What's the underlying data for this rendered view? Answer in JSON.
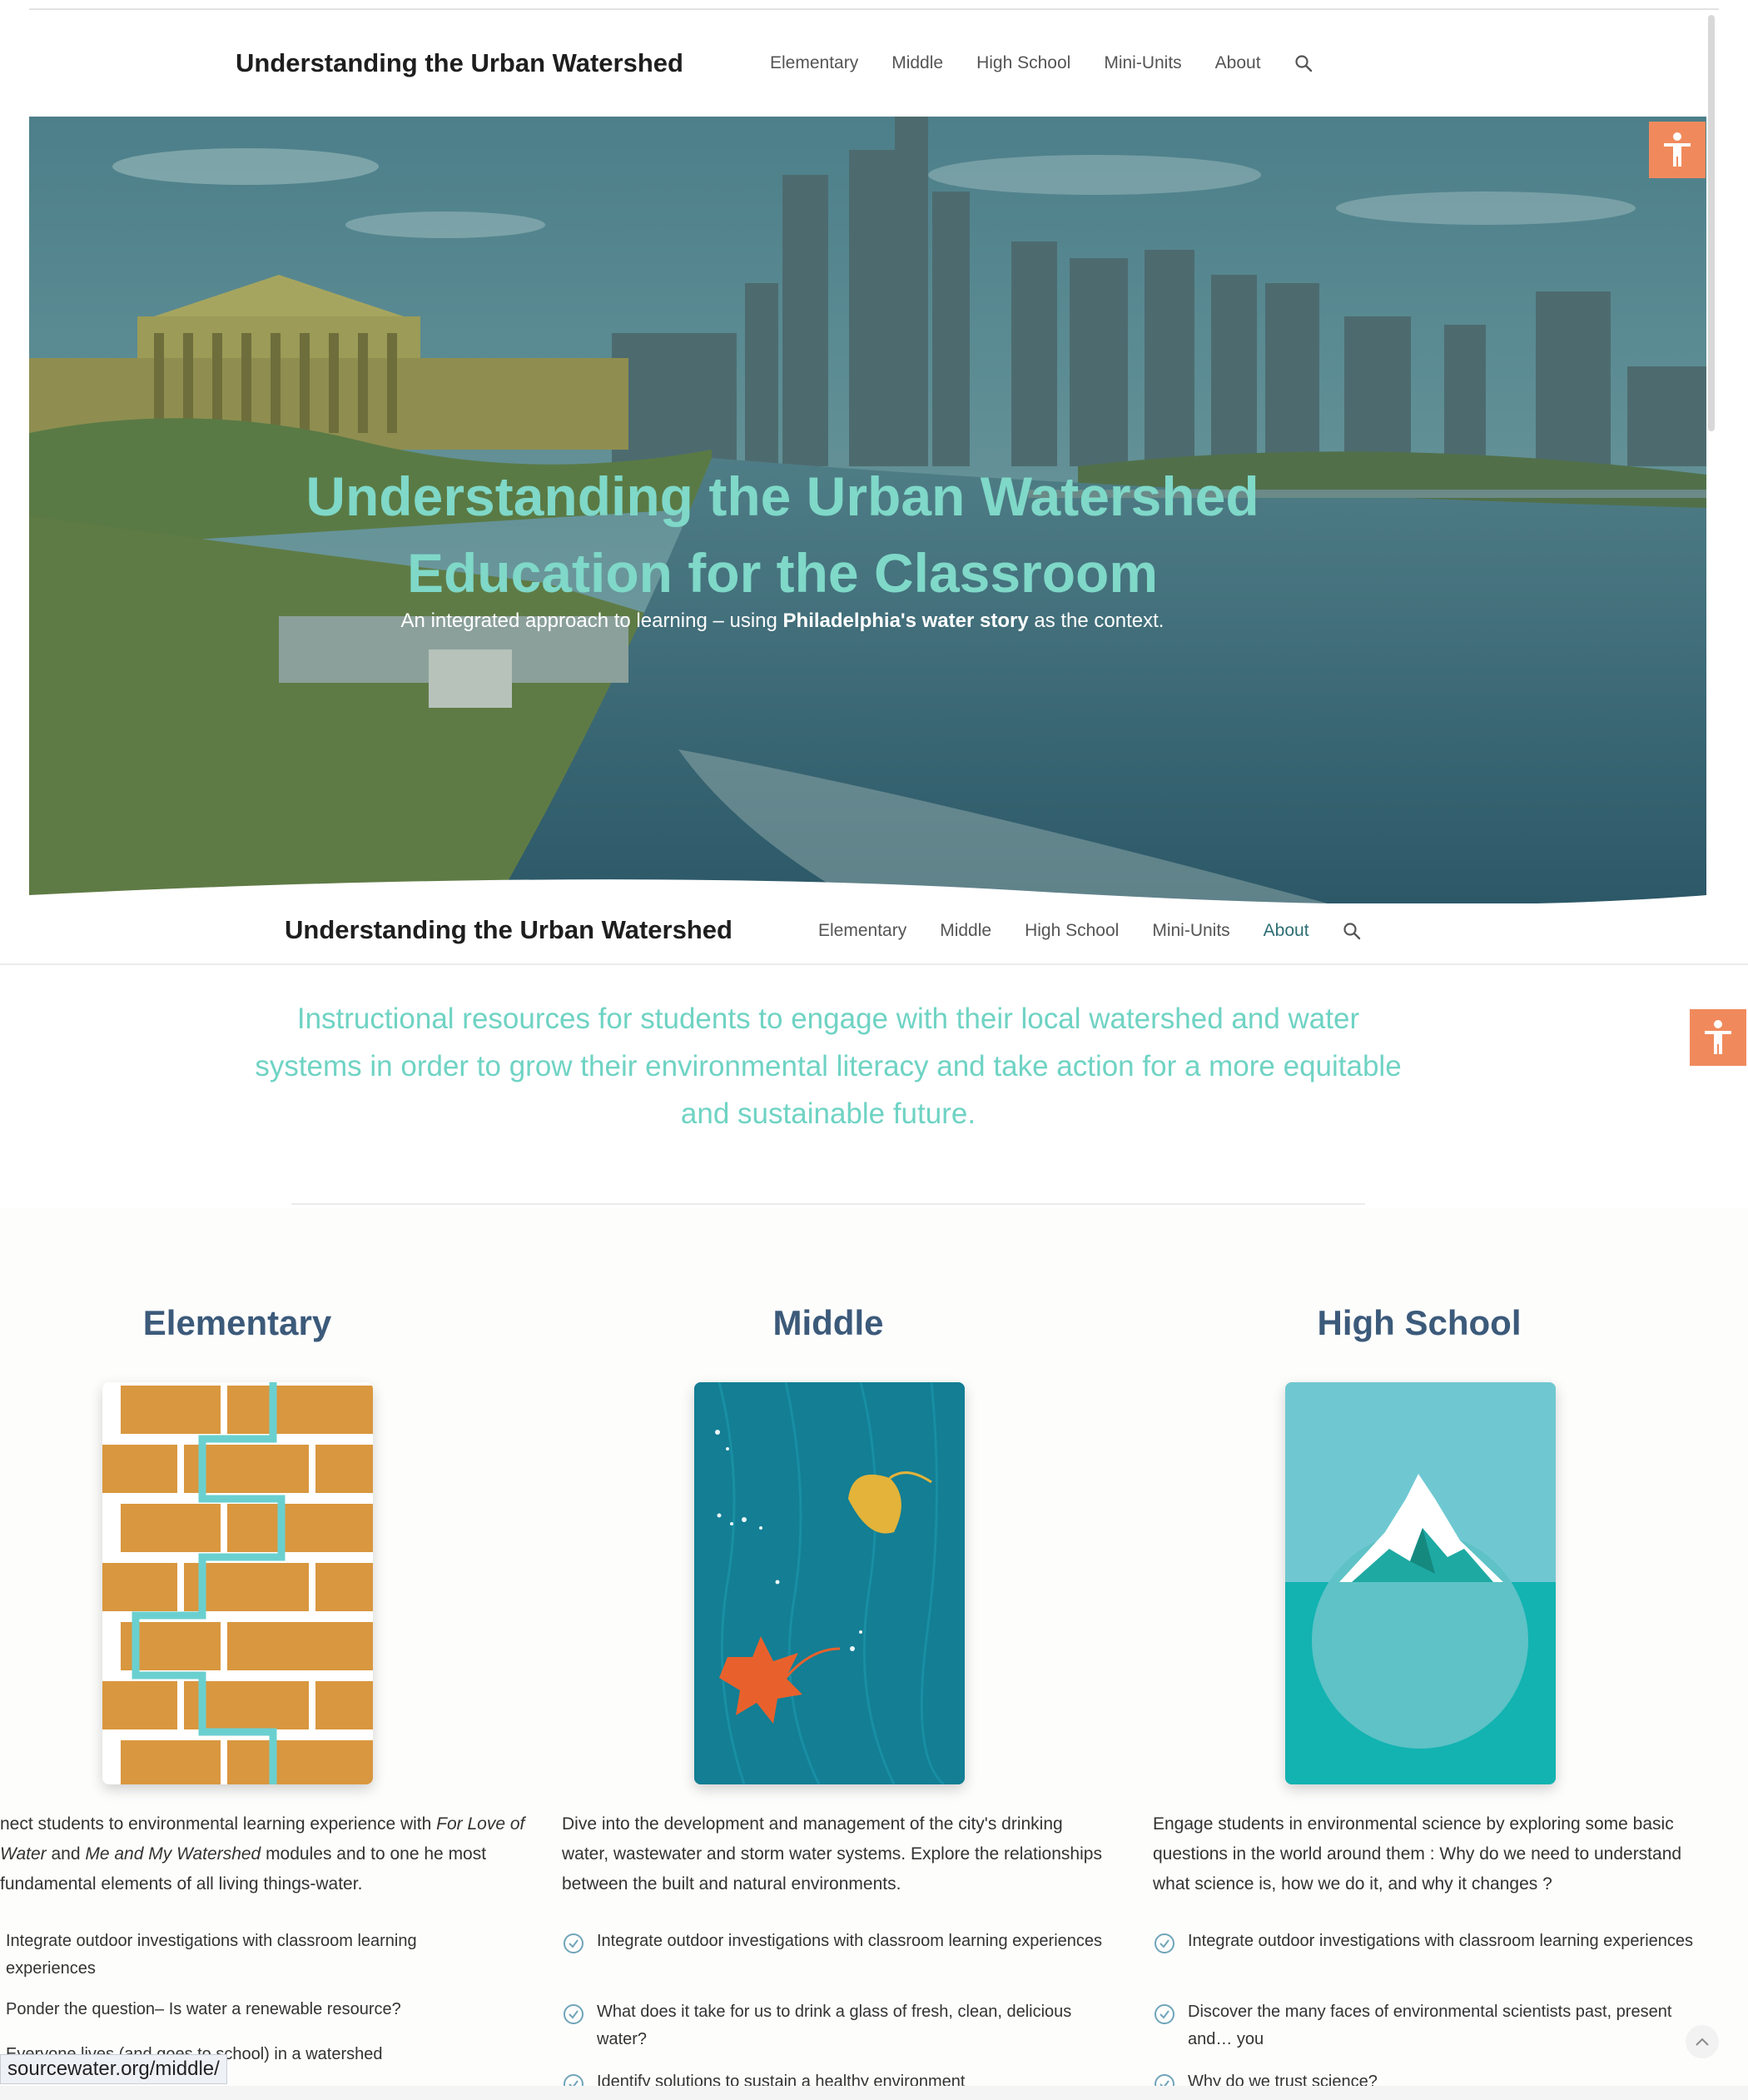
{
  "site": {
    "title": "Understanding the Urban Watershed"
  },
  "nav": {
    "items": [
      "Elementary",
      "Middle",
      "High School",
      "Mini-Units",
      "About"
    ],
    "search_icon": "search-icon"
  },
  "hero": {
    "title_line1": "Understanding the Urban Watershed",
    "title_line2": "Education for the Classroom",
    "subtitle_pre": "An integrated approach to learning – using ",
    "subtitle_bold": "Philadelphia's water story",
    "subtitle_post": " as the context."
  },
  "accessibility_button": {
    "icon": "accessibility-icon",
    "color": "#f08a5d"
  },
  "intro": {
    "text": "Instructional resources for students to engage with their local watershed and water systems in order to grow their environmental literacy and take action for a more equitable and sustainable future."
  },
  "columns": [
    {
      "title": "Elementary",
      "desc_parts": [
        "nect students to environmental learning experience with ",
        "For Love of Water",
        " and ",
        "Me and My Watershed",
        " modules and to one ",
        "he most fundamental elements of all living things-water."
      ],
      "bullets": [
        "Integrate outdoor investigations with classroom learning experiences",
        "Ponder the question– Is water a renewable resource?",
        "Everyone lives (and goes to school) in a watershed"
      ]
    },
    {
      "title": "Middle",
      "desc": "Dive into the development and management of the city's drinking water, wastewater and storm water systems. Explore the relationships between the built and natural environments.",
      "bullets": [
        "Integrate outdoor investigations with classroom learning experiences",
        "What does it take for us to drink a glass of fresh, clean, delicious water?",
        "Identify solutions to sustain a healthy environment"
      ]
    },
    {
      "title": "High School",
      "desc": "Engage students in environmental science by exploring some basic questions in the world around them : Why do we need to understand what science is, how we do it, and why it changes ?",
      "bullets": [
        "Integrate outdoor investigations with classroom learning experiences",
        "Discover the many faces of environmental scientists past, present and… you",
        "Why do we trust science?"
      ]
    }
  ],
  "status_bar": {
    "url": "sourcewater.org/middle/"
  },
  "colors": {
    "accent_teal": "#6fd3c4",
    "heading_navy": "#3c5a7a",
    "accessibility_orange": "#f08a5d",
    "active_nav": "#2d6e73"
  }
}
